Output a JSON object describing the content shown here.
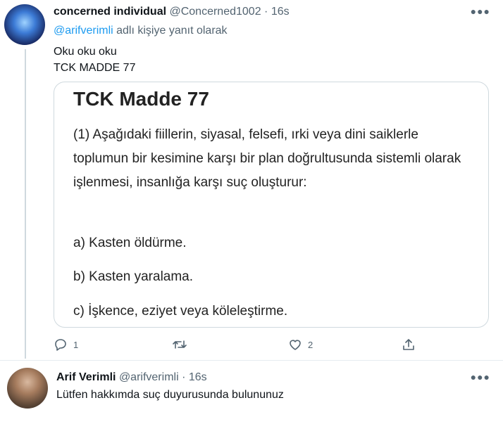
{
  "tweet1": {
    "name": "concerned individual",
    "handle": "@Concerned1002",
    "separator": " · ",
    "time": "16s",
    "reply_mention": "@arifverimli",
    "reply_suffix": " adlı kişiye yanıt olarak",
    "line1": "Oku oku oku",
    "line2": "TCK MADDE 77",
    "more_icon": "more-icon",
    "card": {
      "title": "TCK Madde 77",
      "paragraph": "(1) Aşağıdaki fiillerin, siyasal, felsefi, ırki veya dini saiklerle toplumun bir kesimine karşı bir plan doğrultusunda sistemli olarak işlenmesi, insanlığa karşı suç oluşturur:",
      "item_a": "a) Kasten öldürme.",
      "item_b": "b) Kasten yaralama.",
      "item_c": "c) İşkence, eziyet veya köleleştirme."
    },
    "actions": {
      "reply_count": "1",
      "retweet_count": "",
      "like_count": "2"
    }
  },
  "tweet2": {
    "name": "Arif Verimli",
    "handle": "@arifverimli",
    "separator": " · ",
    "time": "16s",
    "text": "Lütfen hakkımda suç duyurusunda bulununuz"
  },
  "colors": {
    "link": "#1d9bf0",
    "secondary_text": "#536471",
    "border": "#cfd9de"
  }
}
